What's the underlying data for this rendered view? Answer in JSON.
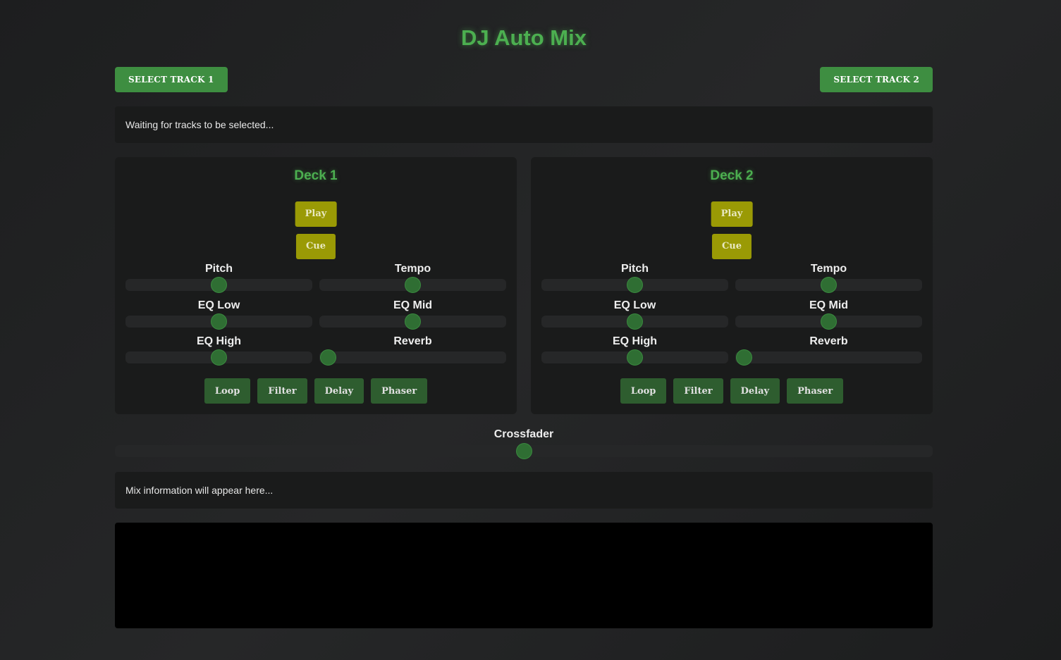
{
  "title": "DJ Auto Mix",
  "select_track_1": "Select Track 1",
  "select_track_2": "Select Track 2",
  "status_text": "Waiting for tracks to be selected...",
  "mix_info_text": "Mix information will appear here...",
  "crossfader": {
    "label": "Crossfader",
    "value": 0.5
  },
  "colors": {
    "accent": "#4caf50",
    "button_green": "#3e8e41",
    "button_yellow": "#9a9a05",
    "fx_button": "#2e5d2f"
  },
  "decks": [
    {
      "title": "Deck 1",
      "play_label": "Play",
      "cue_label": "Cue",
      "controls": [
        {
          "label": "Pitch",
          "value": 0.5
        },
        {
          "label": "Tempo",
          "value": 0.5
        },
        {
          "label": "EQ Low",
          "value": 0.5
        },
        {
          "label": "EQ Mid",
          "value": 0.5
        },
        {
          "label": "EQ High",
          "value": 0.5
        },
        {
          "label": "Reverb",
          "value": 0.0
        }
      ],
      "effects": [
        "Loop",
        "Filter",
        "Delay",
        "Phaser"
      ]
    },
    {
      "title": "Deck 2",
      "play_label": "Play",
      "cue_label": "Cue",
      "controls": [
        {
          "label": "Pitch",
          "value": 0.5
        },
        {
          "label": "Tempo",
          "value": 0.5
        },
        {
          "label": "EQ Low",
          "value": 0.5
        },
        {
          "label": "EQ Mid",
          "value": 0.5
        },
        {
          "label": "EQ High",
          "value": 0.5
        },
        {
          "label": "Reverb",
          "value": 0.0
        }
      ],
      "effects": [
        "Loop",
        "Filter",
        "Delay",
        "Phaser"
      ]
    }
  ]
}
